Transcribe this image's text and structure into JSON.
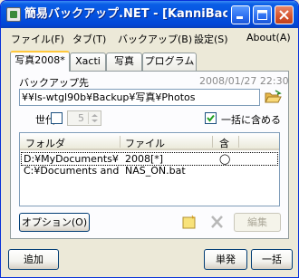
{
  "window": {
    "title": "簡易バックアップ.NET - [KanniBack..."
  },
  "menu": [
    {
      "label": "ファイル(F)"
    },
    {
      "label": "タブ(T)"
    },
    {
      "label": "バックアップ(B)"
    },
    {
      "label": "設定(S)"
    },
    {
      "label": "About(A)"
    }
  ],
  "tabs": [
    {
      "label": "写真2008*",
      "active": true
    },
    {
      "label": "Xacti",
      "active": false
    },
    {
      "label": "写真",
      "active": false
    },
    {
      "label": "プログラム",
      "active": false
    }
  ],
  "panel": {
    "dest_label": "バックアップ先",
    "date": "2008/01/27 22:30",
    "dest_path": "¥¥ls-wtgl90b¥Backup¥写真¥Photos",
    "generation_label": "世代",
    "generation_value": "5",
    "include_all_label": "一括に含める",
    "include_all_checked": true
  },
  "list": {
    "columns": [
      "フォルダ",
      "ファイル",
      "含"
    ],
    "rows": [
      {
        "folder": "D:¥MyDocuments¥...",
        "file": "2008[*]",
        "include": "◯"
      },
      {
        "folder": "C:¥Documents and ...",
        "file": "NAS_ON.bat",
        "include": ""
      }
    ]
  },
  "buttons": {
    "options": "オプション(O)",
    "edit": "編集",
    "add": "追加",
    "single": "単発",
    "batch": "一括"
  },
  "colors": {
    "titlebar": "#0553e0",
    "tab_highlight": "#ffc83c",
    "frame": "#ece9d8"
  }
}
